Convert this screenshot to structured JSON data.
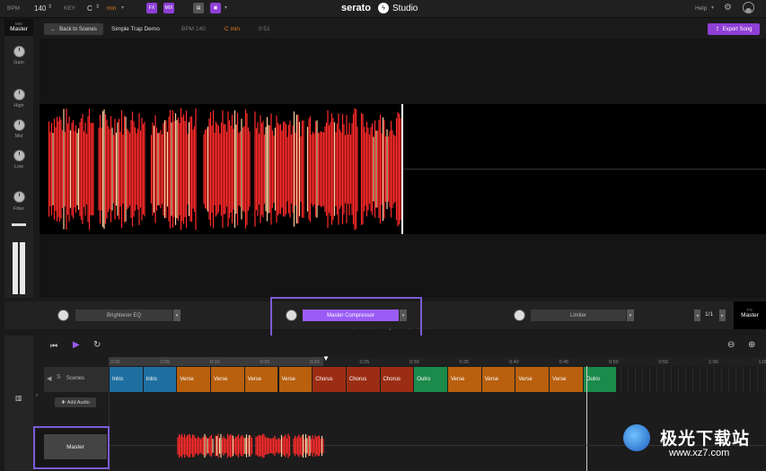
{
  "topbar": {
    "bpm_label": "BPM",
    "bpm_value": "140",
    "key_label": "KEY",
    "key_value": "C",
    "key_mode": "min",
    "fx_label": "FX",
    "mix_label": "MIX",
    "brand": "serato",
    "product": "Studio",
    "help_label": "Help"
  },
  "mixer": {
    "title_small": "MIX",
    "title": "Master",
    "knobs": [
      "Gain",
      "High",
      "Mid",
      "Low",
      "Filter"
    ]
  },
  "header": {
    "back_label": "Back to Scenes",
    "project_name": "Simple Trap Demo",
    "bpm": "BPM 140",
    "key": "C min",
    "duration": "0:51",
    "export_label": "Export Song"
  },
  "fx": {
    "slot1": "Brightener EQ",
    "slot2": "Master Compressor",
    "slot3": "Limiter",
    "page": "1/1",
    "panel_small": "FX",
    "panel_title": "Master"
  },
  "timeline": {
    "ticks": [
      "0:00",
      "0:05",
      "0:10",
      "0:15",
      "0:20",
      "0:25",
      "0:30",
      "0:35",
      "0:40",
      "0:45",
      "0:50",
      "0:55",
      "1:00",
      "1:05"
    ],
    "scenes_label": "Scenes",
    "add_audio": "Add Audio",
    "master_label": "Master",
    "scenes": [
      {
        "name": "Intro",
        "color": "#1e6fa0"
      },
      {
        "name": "Intro",
        "color": "#1e6fa0"
      },
      {
        "name": "Verse",
        "color": "#b8600e"
      },
      {
        "name": "Verse",
        "color": "#b8600e"
      },
      {
        "name": "Verse",
        "color": "#b8600e"
      },
      {
        "name": "Verse",
        "color": "#b8600e"
      },
      {
        "name": "Chorus",
        "color": "#9b2d14"
      },
      {
        "name": "Chorus",
        "color": "#9b2d14"
      },
      {
        "name": "Chorus",
        "color": "#9b2d14"
      },
      {
        "name": "Outro",
        "color": "#1b8a4a"
      },
      {
        "name": "Verse",
        "color": "#b8600e"
      },
      {
        "name": "Verse",
        "color": "#b8600e"
      },
      {
        "name": "Verse",
        "color": "#b8600e"
      },
      {
        "name": "Verse",
        "color": "#b8600e"
      },
      {
        "name": "Outro",
        "color": "#1b8a4a"
      }
    ]
  },
  "watermark": {
    "text": "极光下载站",
    "url": "www.xz7.com"
  },
  "colors": {
    "accent": "#9b5cf6",
    "key_orange": "#e0801c",
    "wave_red": "#ff2a2a"
  }
}
